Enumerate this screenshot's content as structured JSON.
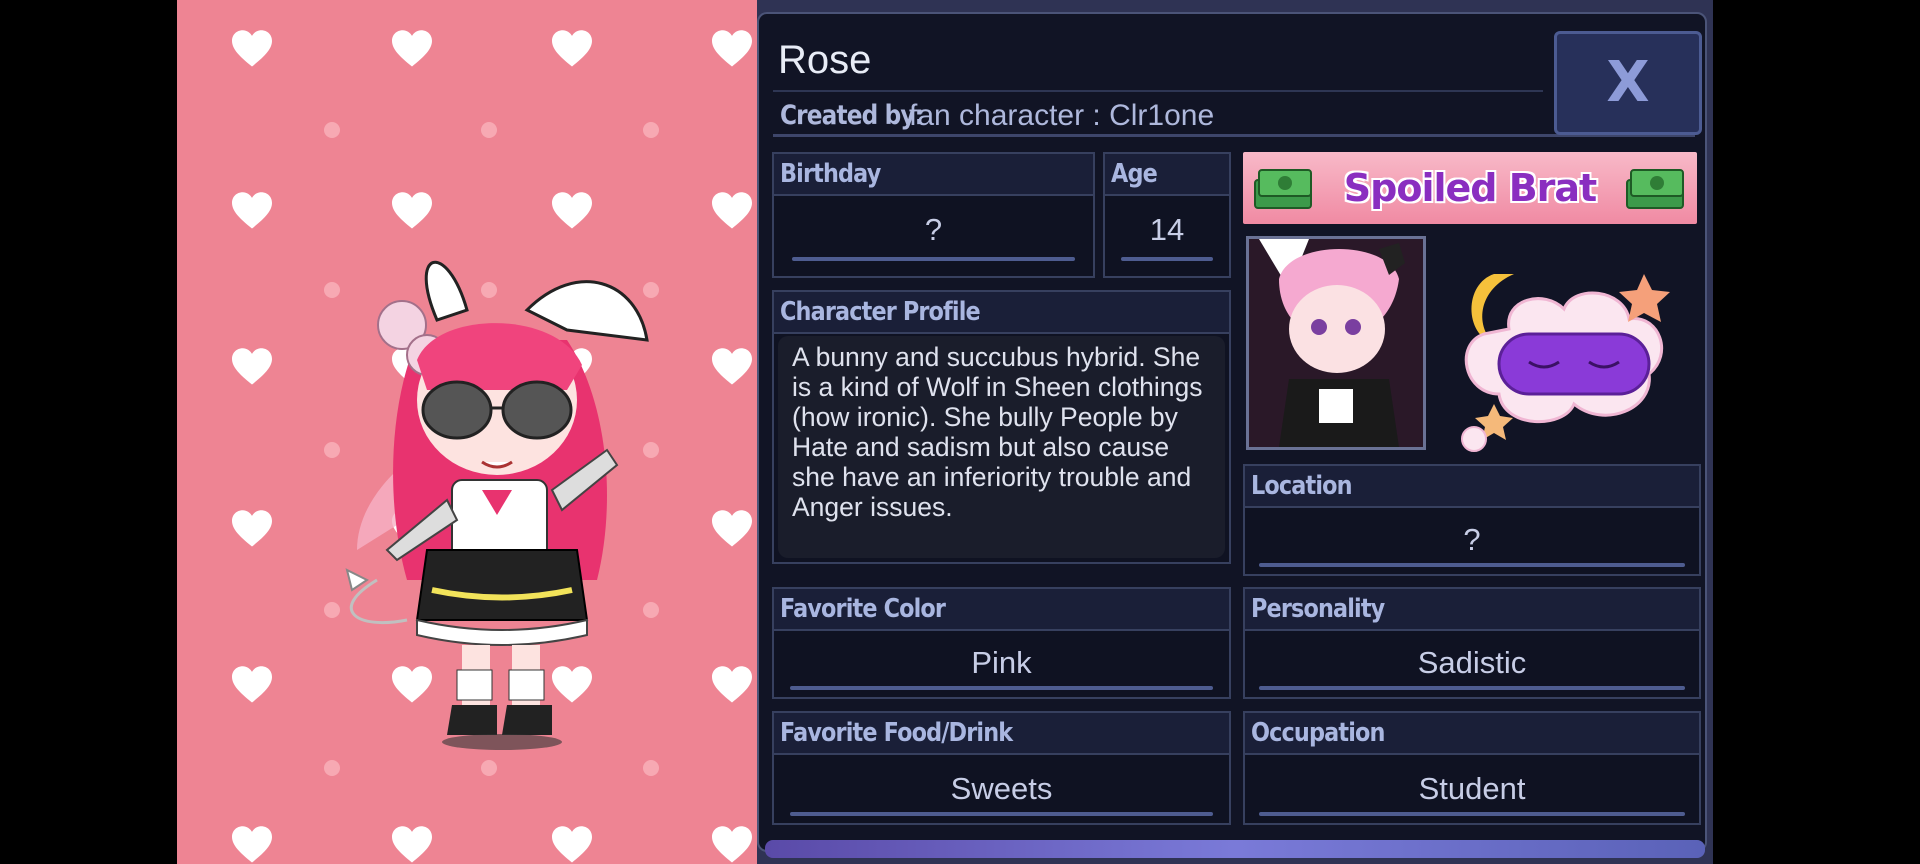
{
  "character": {
    "name": "Rose",
    "created_by_label": "Created by:",
    "created_by_value": "fan character : Clr1one"
  },
  "close_button": {
    "label": "X"
  },
  "fields": {
    "birthday": {
      "label": "Birthday",
      "value": "?"
    },
    "age": {
      "label": "Age",
      "value": "14"
    },
    "profile": {
      "label": "Character Profile",
      "text": "A bunny and succubus hybrid. She is a kind of Wolf in Sheen clothings (how ironic). She bully People by Hate and sadism but also cause she have an inferiority trouble and Anger issues."
    },
    "location": {
      "label": "Location",
      "value": "?"
    },
    "favorite_color": {
      "label": "Favorite Color",
      "value": "Pink"
    },
    "personality": {
      "label": "Personality",
      "value": "Sadistic"
    },
    "favorite_food": {
      "label": "Favorite Food/Drink",
      "value": "Sweets"
    },
    "occupation": {
      "label": "Occupation",
      "value": "Student"
    }
  },
  "trait_badge": {
    "label": "Spoiled Brat",
    "icon": "money-stack-icon"
  },
  "trait_icon": "sleep-mask-cloud-icon",
  "colors": {
    "stage_bg": "#ee8493",
    "panel_bg": "#111425",
    "header_bg": "#1a1f38",
    "accent": "#4e5c90"
  }
}
